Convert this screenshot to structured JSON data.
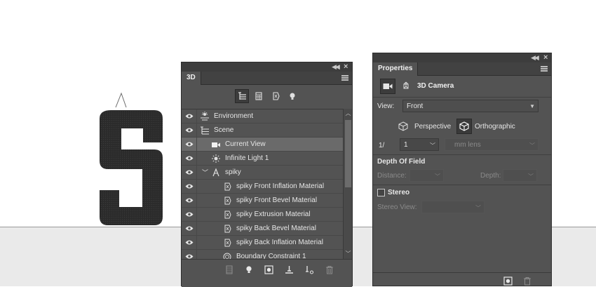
{
  "panel3d": {
    "tab_label": "3D",
    "filters": [
      "scene-filter-icon",
      "mesh-filter-icon",
      "material-filter-icon",
      "light-filter-icon"
    ],
    "items": [
      {
        "label": "Environment",
        "icon": "environment-icon"
      },
      {
        "label": "Scene",
        "icon": "scene-icon"
      },
      {
        "label": "Current View",
        "icon": "camera-icon",
        "selected": true
      },
      {
        "label": "Infinite Light 1",
        "icon": "light-icon"
      },
      {
        "label": "spiky",
        "icon": "mesh-icon",
        "expanded": true
      },
      {
        "label": "spiky Front Inflation Material",
        "icon": "material-icon"
      },
      {
        "label": "spiky Front Bevel Material",
        "icon": "material-icon"
      },
      {
        "label": "spiky Extrusion Material",
        "icon": "material-icon"
      },
      {
        "label": "spiky Back Bevel Material",
        "icon": "material-icon"
      },
      {
        "label": "spiky Back Inflation Material",
        "icon": "material-icon"
      },
      {
        "label": "Boundary Constraint 1",
        "icon": "constraint-icon"
      }
    ],
    "bottom_tools": [
      "mesh-tool-icon",
      "add-light-icon",
      "render-icon",
      "ground-icon",
      "constraint-tool-icon",
      "trash-icon"
    ]
  },
  "properties": {
    "tab_label": "Properties",
    "camera_title": "3D Camera",
    "view_label": "View:",
    "view_value": "Front",
    "perspective_label": "Perspective",
    "orthographic_label": "Orthographic",
    "projection": "orthographic",
    "zoom_prefix": "1/",
    "zoom_value": "1",
    "lens_placeholder": "mm lens",
    "dof_title": "Depth Of Field",
    "distance_label": "Distance:",
    "depth_label": "Depth:",
    "stereo_label": "Stereo",
    "stereo_checked": false,
    "stereo_view_label": "Stereo View:"
  },
  "canvas": {
    "letter": "S",
    "floor_color": "#eaeaea",
    "letter_color": "#2b2b2b"
  }
}
